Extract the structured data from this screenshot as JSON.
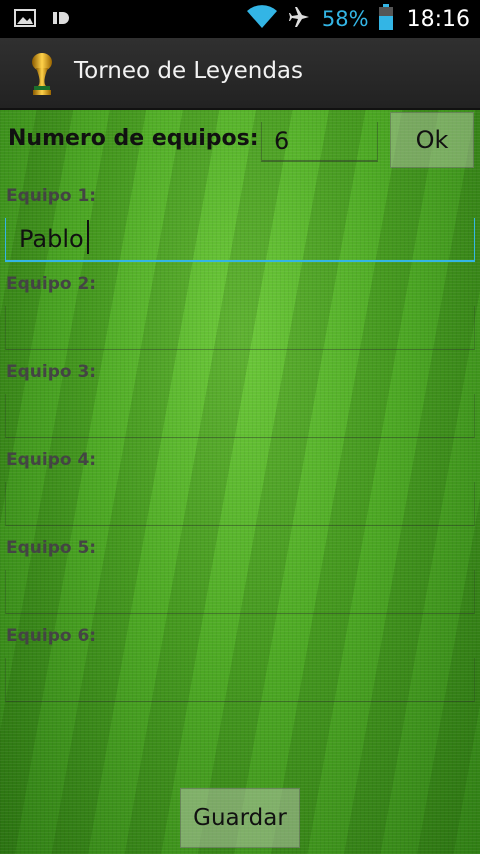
{
  "status_bar": {
    "battery_percent": "58%",
    "time": "18:16",
    "icons": [
      "image-icon",
      "notification-icon",
      "wifi-icon",
      "airplane-icon",
      "battery-icon"
    ],
    "accent_color": "#33b5e5"
  },
  "action_bar": {
    "title": "Torneo de Leyendas",
    "icon": "trophy-icon"
  },
  "form": {
    "num_teams_label": "Numero de equipos:",
    "num_teams_value": "6",
    "ok_label": "Ok",
    "teams": [
      {
        "label": "Equipo 1:",
        "value": "Pablo"
      },
      {
        "label": "Equipo 2:",
        "value": ""
      },
      {
        "label": "Equipo 3:",
        "value": ""
      },
      {
        "label": "Equipo 4:",
        "value": ""
      },
      {
        "label": "Equipo 5:",
        "value": ""
      },
      {
        "label": "Equipo 6:",
        "value": ""
      }
    ],
    "save_label": "Guardar"
  }
}
